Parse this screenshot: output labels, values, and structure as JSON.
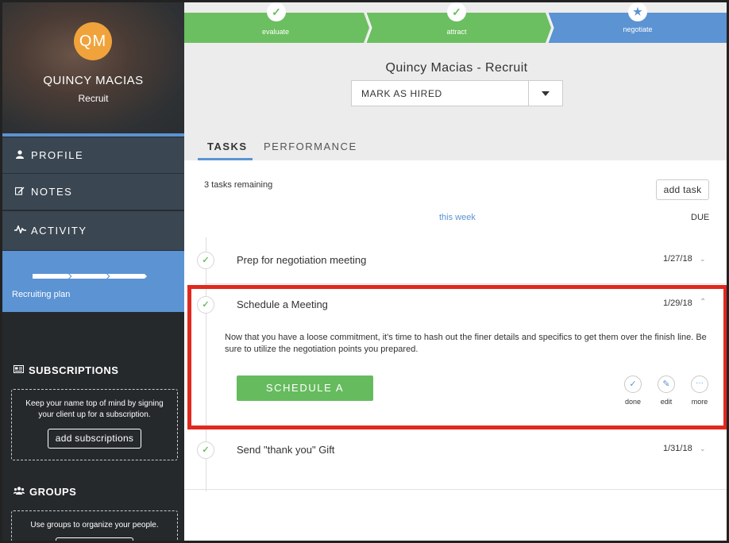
{
  "profile": {
    "initials": "QM",
    "name": "QUINCY MACIAS",
    "role": "Recruit"
  },
  "nav": [
    {
      "label": "PROFILE",
      "icon": "user-icon"
    },
    {
      "label": "NOTES",
      "icon": "edit-note-icon"
    },
    {
      "label": "ACTIVITY",
      "icon": "activity-pulse-icon"
    }
  ],
  "plan": {
    "label": "Recruiting plan"
  },
  "subscriptions": {
    "title": "SUBSCRIPTIONS",
    "text": "Keep your name top of mind by signing your client up for a subscription.",
    "button": "add subscriptions"
  },
  "groups": {
    "title": "GROUPS",
    "text": "Use groups to organize your people."
  },
  "stepper": [
    {
      "label": "evaluate",
      "state": "done"
    },
    {
      "label": "attract",
      "state": "done"
    },
    {
      "label": "negotiate",
      "state": "current"
    }
  ],
  "header": {
    "title": "Quincy Macias - Recruit",
    "status_select": "MARK AS HIRED"
  },
  "tabs": [
    {
      "label": "TASKS",
      "active": true
    },
    {
      "label": "PERFORMANCE",
      "active": false
    }
  ],
  "tasks_panel": {
    "remaining": "3 tasks remaining",
    "add_task": "add task",
    "week_label": "this week",
    "due_label": "DUE"
  },
  "tasks": [
    {
      "title": "Prep for negotiation meeting",
      "due": "1/27/18"
    },
    {
      "title": "Schedule a Meeting",
      "due": "1/29/18",
      "description": "Now that you have a loose commitment, it's time to hash out the finer details and specifics to get them over the finish line. Be sure to utilize the negotiation points you prepared.",
      "cta": "SCHEDULE A MEETING",
      "actions": [
        "done",
        "edit",
        "more"
      ]
    },
    {
      "title": "Send \"thank you\" Gift",
      "due": "1/31/18"
    }
  ],
  "colors": {
    "accent_blue": "#5b93d3",
    "success_green": "#66bb5e",
    "highlight_red": "#e0291e",
    "avatar_orange": "#f0a33b",
    "sidebar_dark": "#26292c"
  }
}
